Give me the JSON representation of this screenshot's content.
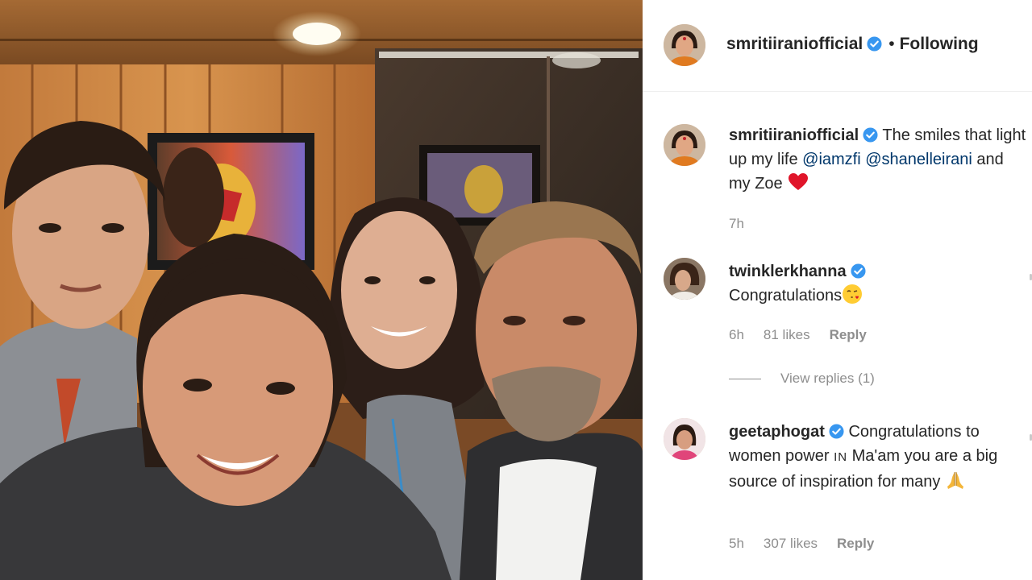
{
  "post": {
    "author": "smritiiraniofficial",
    "follow_separator": "•",
    "follow_status": "Following",
    "photo_alt_icon": "family-selfie-photo"
  },
  "caption": {
    "username": "smritiiraniofficial",
    "text_before": "The smiles that light up my life",
    "mention_1": "@iamzfi",
    "mention_2": "@shanelleirani",
    "text_after": "and my Zoe",
    "emoji": "red-heart-icon",
    "time": "7h"
  },
  "comments": [
    {
      "username": "twinklerkhanna",
      "text": "Congratulations",
      "emoji": "face-blowing-kiss-icon",
      "time": "6h",
      "likes": "81 likes",
      "reply": "Reply",
      "view_replies": "View replies (1)"
    },
    {
      "username": "geetaphogat",
      "text_before": "Congratulations to women power",
      "small_caps": "IN",
      "text_after": "Ma'am you are a big source of inspiration for many",
      "emoji": "folded-hands-icon",
      "time": "5h",
      "likes": "307 likes",
      "reply": "Reply"
    }
  ],
  "colors": {
    "verified_badge": "#3897f0",
    "mention_link": "#00376b",
    "meta_gray": "#8e8e8e",
    "divider": "#efefef"
  }
}
